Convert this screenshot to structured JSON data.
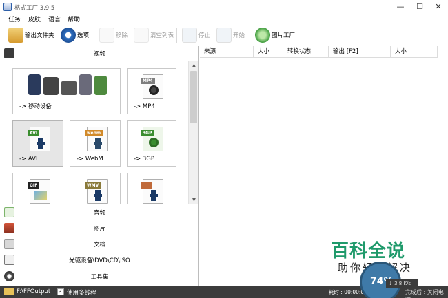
{
  "window": {
    "title": "格式工厂 3.9.5",
    "controls": {
      "minimize": "—",
      "maximize": "☐",
      "close": "✕"
    }
  },
  "menu": [
    "任务",
    "皮肤",
    "语言",
    "帮助"
  ],
  "toolbar": {
    "output_folder": "输出文件夹",
    "options": "选项",
    "remove": "移除",
    "clear_list": "清空列表",
    "stop": "停止",
    "start": "开始",
    "picture_factory": "图片工厂"
  },
  "categories": {
    "video": "视频",
    "audio": "音频",
    "picture": "图片",
    "document": "文档",
    "rom": "光驱设备\\DVD\\CD\\ISO",
    "tools": "工具集"
  },
  "video_formats": [
    {
      "label": "-> 移动设备",
      "icon": "mobile-devices-icon"
    },
    {
      "label": "-> MP4",
      "tag": "MP4",
      "icon": "mp4-file-icon"
    },
    {
      "label": "-> AVI",
      "tag": "AVI",
      "icon": "avi-file-icon"
    },
    {
      "label": "-> WebM",
      "tag": "webm",
      "icon": "webm-file-icon"
    },
    {
      "label": "-> 3GP",
      "tag": "3GP",
      "icon": "3gp-file-icon"
    },
    {
      "label": "",
      "tag": "GIF",
      "icon": "gif-file-icon"
    },
    {
      "label": "",
      "tag": "WMV",
      "icon": "wmv-file-icon"
    },
    {
      "label": "",
      "tag": "",
      "icon": "video-file-icon"
    }
  ],
  "task_columns": [
    "来源",
    "大小",
    "转换状态",
    "输出 [F2]",
    "大小"
  ],
  "status": {
    "output_path": "F:\\FFOutput",
    "multithread_label": "使用多线程",
    "multithread_checked": "✓",
    "elapsed": "耗时 : 00:00:00",
    "speed_percent": "74%",
    "speed_rate": "↓ 3.8 K/s",
    "after_finish": "完成后 : 关闭电脑"
  },
  "watermark": {
    "main": "百科全说",
    "sub": "助你轻松解决"
  },
  "colors": {
    "status_bg": "#3c3c3c",
    "watermark_green": "#1f9a6b",
    "selected_tile": "#e6e6e6"
  }
}
